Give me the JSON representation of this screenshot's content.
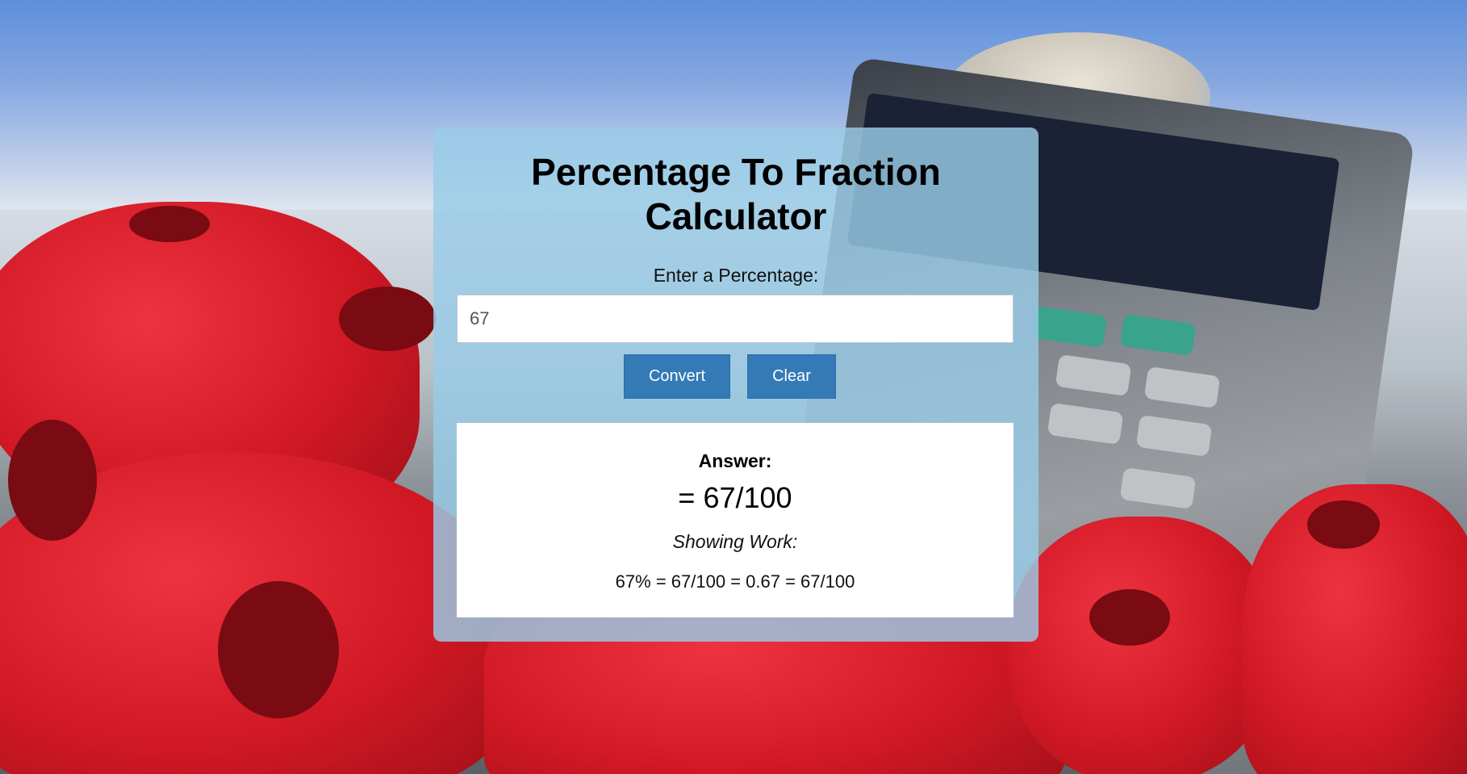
{
  "calculator": {
    "title_line1": "Percentage To Fraction",
    "title_line2": "Calculator",
    "input_label": "Enter a Percentage:",
    "input_value": "67",
    "convert_label": "Convert",
    "clear_label": "Clear"
  },
  "result": {
    "answer_label": "Answer:",
    "answer_value": "= 67/100",
    "work_label": "Showing Work:",
    "work_value": "67% = 67/100 = 0.67 = 67/100"
  },
  "colors": {
    "card_background": "#99cce6",
    "button": "#337ab7",
    "button_text": "#ffffff",
    "result_background": "#ffffff"
  },
  "background": {
    "icon": "percent-sign-calculator-photo"
  }
}
